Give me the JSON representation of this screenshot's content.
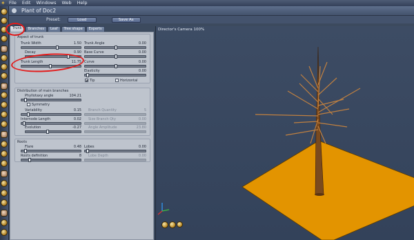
{
  "menu": [
    "File",
    "Edit",
    "Windows",
    "Web",
    "Help"
  ],
  "window": {
    "title": "Plant of Doc2"
  },
  "presetbar": {
    "label": "Preset:",
    "load": "Load",
    "save_as": "Save As"
  },
  "tabs": [
    "Trunk",
    "Branches",
    "Leaf",
    "Tree shape",
    "Experts"
  ],
  "active_tab": "Trunk",
  "aspect": {
    "title": "Aspect of trunk",
    "trunk_width": {
      "label": "Trunk Width",
      "value": "1.50"
    },
    "decay": {
      "label": "Decay",
      "value": "0.90"
    },
    "trunk_length": {
      "label": "Trunk Length",
      "value": "11.75"
    },
    "trunk_angle": {
      "label": "Trunk Angle",
      "value": "0.00"
    },
    "base_curve": {
      "label": "Base Curve",
      "value": "0.00"
    },
    "curve": {
      "label": "Curve",
      "value": "0.00"
    },
    "elasticity": {
      "label": "Elasticity",
      "value": "0.00"
    },
    "tip": {
      "label": "Tip",
      "checked": true
    },
    "horizontal": {
      "label": "Horizontal",
      "checked": false
    }
  },
  "distribution": {
    "title": "Distribution of main branches",
    "phyllotaxy": {
      "label": "Phyllotaxy angle",
      "value": "104.21"
    },
    "symmetry": {
      "label": "Symmetry",
      "checked": false
    },
    "variability": {
      "label": "Variability",
      "value": "0.15"
    },
    "internode": {
      "label": "Internode Length",
      "value": "0.02"
    },
    "evolution": {
      "label": "Evolution",
      "value": "-0.27"
    },
    "branch_quantity": {
      "label": "Branch Quantity",
      "value": "5"
    },
    "size_branch_qty": {
      "label": "Size Branch Qty",
      "value": "0.00"
    },
    "angle_amplitude": {
      "label": "Angle Amplitude",
      "value": "23.80"
    }
  },
  "roots": {
    "title": "Roots",
    "flare": {
      "label": "Flare",
      "value": "0.48"
    },
    "roots_definition": {
      "label": "Roots definition",
      "value": "8"
    },
    "lobes": {
      "label": "Lobes",
      "value": "0.00"
    },
    "lobe_depth": {
      "label": "Lobe Depth",
      "value": "0.00"
    }
  },
  "viewport": {
    "camera_label": "Director's Camera 100%"
  },
  "colors": {
    "ground": "#e39400",
    "tree": "#7a4a1e",
    "annotation": "#e31b1b",
    "viewport_bg": "#3d4c64"
  },
  "icons": [
    "app-logo-icon",
    "rotate-camera-icon",
    "move-camera-icon",
    "zoom-camera-icon"
  ]
}
